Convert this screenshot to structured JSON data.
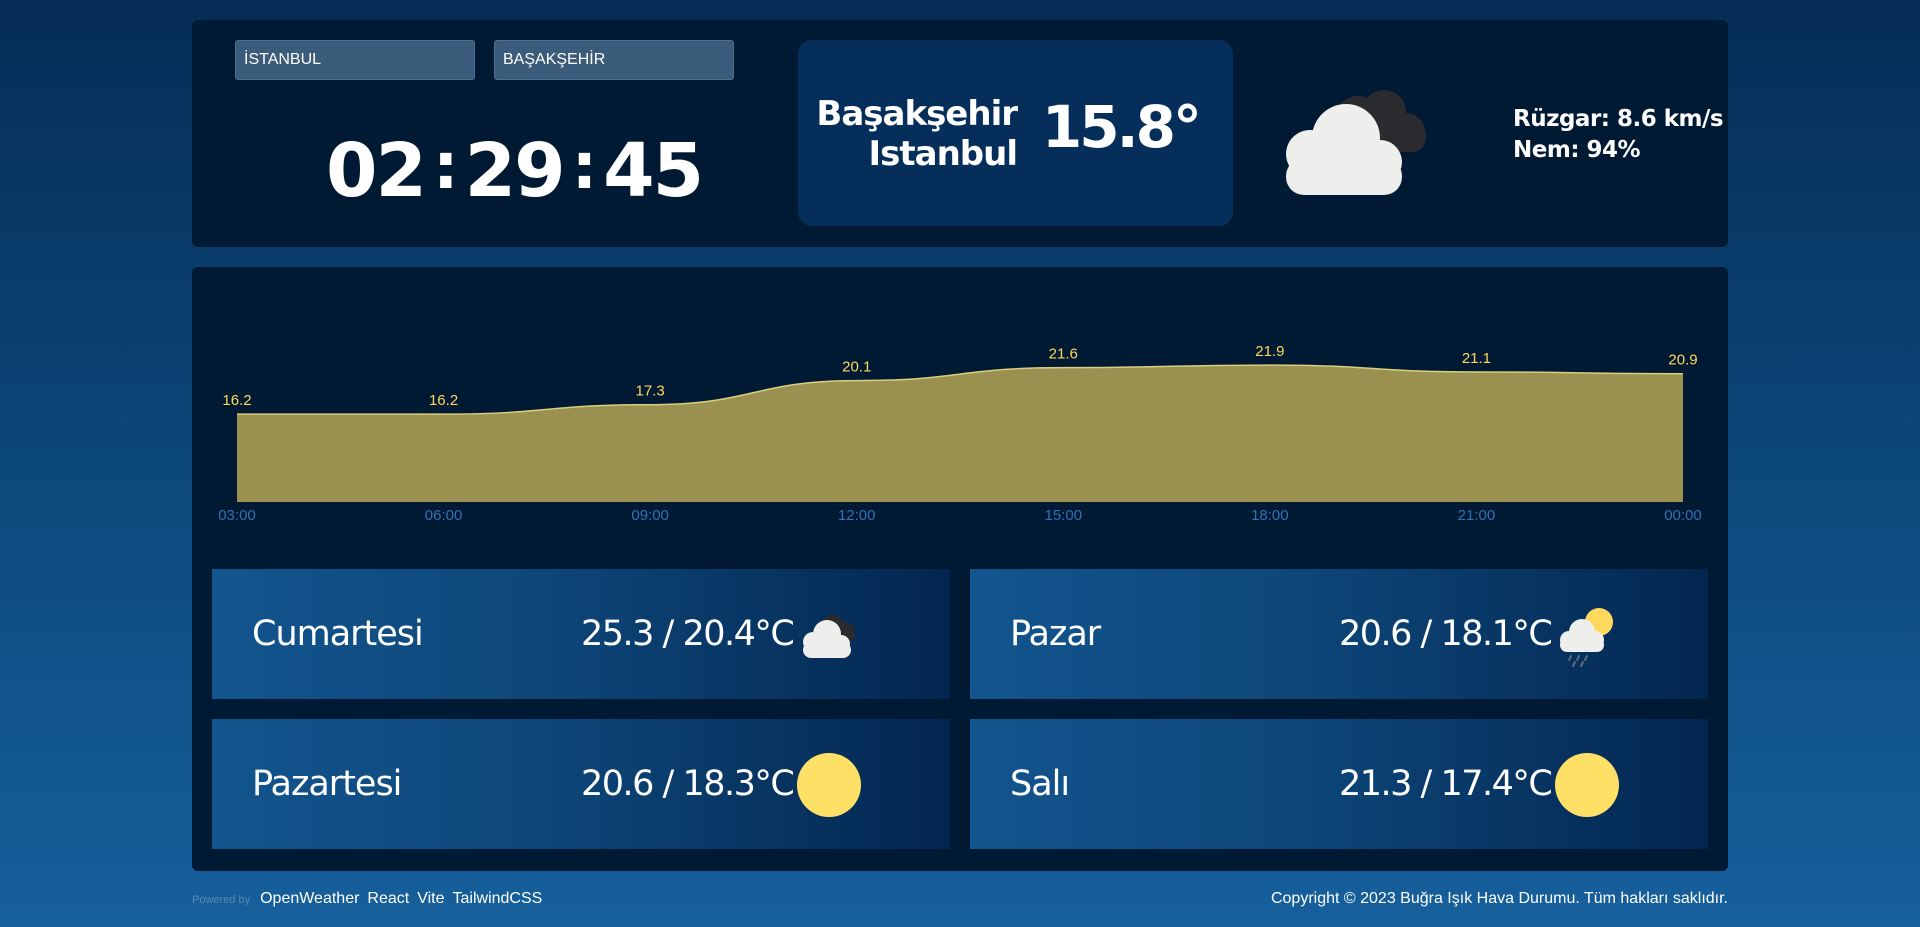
{
  "selectors": {
    "city": "İSTANBUL",
    "district": "BAŞAKŞEHİR"
  },
  "clock": {
    "hours": "02",
    "minutes": "29",
    "seconds": "45",
    "separator": ":"
  },
  "current": {
    "district": "Başakşehir",
    "city": "Istanbul",
    "temperature": "15.8°",
    "icon": "cloudy-icon",
    "wind": "Rüzgar: 8.6 km/s",
    "humidity": "Nem: 94%"
  },
  "chart_data": {
    "type": "area",
    "x": [
      "03:00",
      "06:00",
      "09:00",
      "12:00",
      "15:00",
      "18:00",
      "21:00",
      "00:00"
    ],
    "values": [
      16.2,
      16.2,
      17.3,
      20.1,
      21.6,
      21.9,
      21.1,
      20.9
    ],
    "title": "",
    "xlabel": "",
    "ylabel": "",
    "grid": false,
    "colors": {
      "fill": "#9a9150",
      "line": "#d9cf80",
      "labels": "#ffd75e",
      "ticks": "#2f72b5"
    }
  },
  "forecast": [
    {
      "day": "Cumartesi",
      "temp": "25.3 / 20.4°C",
      "icon": "cloudy-icon"
    },
    {
      "day": "Pazar",
      "temp": "20.6 / 18.1°C",
      "icon": "rain-sun-icon"
    },
    {
      "day": "Pazartesi",
      "temp": "20.6 / 18.3°C",
      "icon": "sun-icon"
    },
    {
      "day": "Salı",
      "temp": "21.3 / 17.4°C",
      "icon": "sun-icon"
    }
  ],
  "footer": {
    "powered_by": "Powered by",
    "links": [
      "OpenWeather",
      "React",
      "Vite",
      "TailwindCSS"
    ],
    "copyright": "Copyright © 2023 Buğra Işık Hava Durumu. Tüm hakları saklıdır."
  }
}
